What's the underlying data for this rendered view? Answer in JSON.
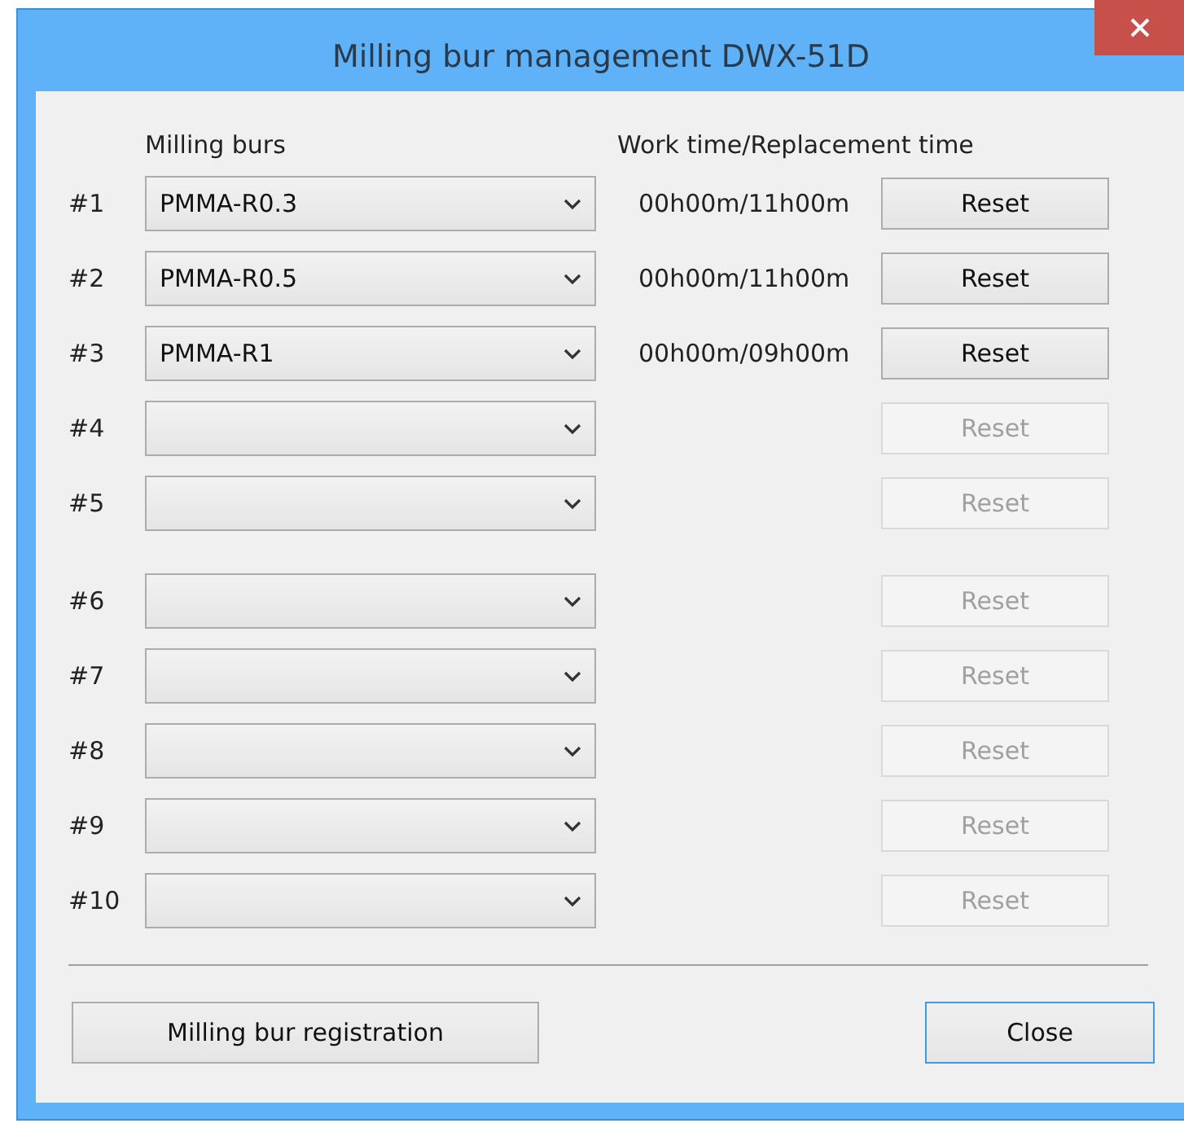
{
  "window": {
    "title": "Milling bur management DWX-51D"
  },
  "columns": [
    "Milling burs",
    "Work time/Replacement time"
  ],
  "bur_groups": [
    [
      {
        "number": "#1",
        "bur": "PMMA-R0.3",
        "time": "00h00m/11h00m",
        "reset": "Reset",
        "reset_enabled": true
      },
      {
        "number": "#2",
        "bur": "PMMA-R0.5",
        "time": "00h00m/11h00m",
        "reset": "Reset",
        "reset_enabled": true
      },
      {
        "number": "#3",
        "bur": "PMMA-R1",
        "time": "00h00m/09h00m",
        "reset": "Reset",
        "reset_enabled": true
      },
      {
        "number": "#4",
        "reset": "Reset",
        "reset_enabled": false
      },
      {
        "number": "#5",
        "reset": "Reset",
        "reset_enabled": false
      }
    ],
    [
      {
        "number": "#6",
        "reset": "Reset",
        "reset_enabled": false
      },
      {
        "number": "#7",
        "reset": "Reset",
        "reset_enabled": false
      },
      {
        "number": "#8",
        "reset": "Reset",
        "reset_enabled": false
      },
      {
        "number": "#9",
        "reset": "Reset",
        "reset_enabled": false
      },
      {
        "number": "#10",
        "reset": "Reset",
        "reset_enabled": false
      }
    ]
  ],
  "buttons": [
    {
      "label": "Milling bur registration",
      "default": false
    },
    {
      "label": "Close",
      "default": true
    }
  ]
}
